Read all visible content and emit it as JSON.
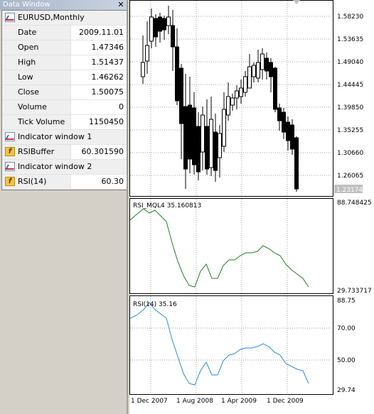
{
  "data_window": {
    "title": "Data Window",
    "close_glyph": "✕",
    "symbol": "EURUSD,Monthly",
    "rows": [
      {
        "label": "Date",
        "value": "2009.11.01"
      },
      {
        "label": "Open",
        "value": "1.47346"
      },
      {
        "label": "High",
        "value": "1.51437"
      },
      {
        "label": "Low",
        "value": "1.46262"
      },
      {
        "label": "Close",
        "value": "1.50075"
      },
      {
        "label": "Volume",
        "value": "0"
      },
      {
        "label": "Tick Volume",
        "value": "1150450"
      }
    ],
    "indicator1": {
      "header": "Indicator window 1",
      "label": "RSIBuffer",
      "value": "60.301590"
    },
    "indicator2": {
      "header": "Indicator window 2",
      "label": "RSI(14)",
      "value": "60.30"
    }
  },
  "chart": {
    "price_scale": [
      "1.58230",
      "1.53635",
      "1.49040",
      "1.44445",
      "1.39850",
      "1.35255",
      "1.30660",
      "1.26065"
    ],
    "current_price": "1.23174",
    "rsi1_label": "RSI_MQL4 35.160813",
    "rsi1_max": "88.748425",
    "rsi1_min": "29.733717",
    "rsi2_label": "RSI(14) 35.16",
    "rsi2_scale": [
      "88.75",
      "70.00",
      "50.00",
      "29.74"
    ],
    "time_labels": [
      "1 Dec 2007",
      "1 Aug 2008",
      "1 Apr 2009",
      "1 Dec 2009"
    ],
    "colors": {
      "bull": "#ffffff",
      "bear": "#000000",
      "rsi1": "#1e7d1e",
      "rsi2": "#2a8ad8",
      "grid": "#a0a0a0"
    }
  }
}
